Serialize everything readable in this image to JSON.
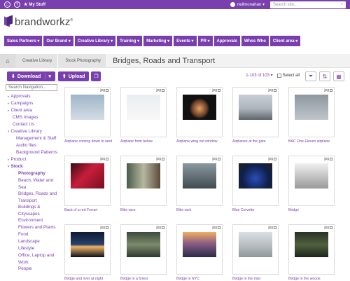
{
  "topbar": {
    "my_stuff": "My Stuff",
    "user": "neilmonahan ▾",
    "search_placeholder": "Search site..."
  },
  "logo": {
    "text": "brandworkz"
  },
  "nav": [
    "Sales Partners ▾",
    "Our Brand ▾",
    "Creative Library ▾",
    "Training ▾",
    "Marketing ▾",
    "Events ▾",
    "PR ▾",
    "Approvals",
    "Whos Who",
    "Client area ▾"
  ],
  "breadcrumb": {
    "items": [
      "Creative Library",
      "Stock Photography"
    ],
    "title": "Bridges, Roads and Transport"
  },
  "toolbar": {
    "download": "Download",
    "upload": "Upload",
    "count": "1-103 of 103 ▾",
    "select_all": "Select all"
  },
  "sidebar": {
    "search_placeholder": "Search Navigation...",
    "tree": [
      {
        "label": "Approvals",
        "level": "l0",
        "arrow": "▸"
      },
      {
        "label": "Campaigns",
        "level": "l0",
        "arrow": "▸"
      },
      {
        "label": "Client area",
        "level": "l0",
        "arrow": "▸"
      },
      {
        "label": "CMS Images",
        "level": "l1",
        "arrow": ""
      },
      {
        "label": "Contact Us",
        "level": "l1",
        "arrow": ""
      },
      {
        "label": "Creative Library",
        "level": "l0",
        "arrow": "▾"
      },
      {
        "label": "Management & Staff",
        "level": "l2",
        "arrow": ""
      },
      {
        "label": "Audio files",
        "level": "l2",
        "arrow": ""
      },
      {
        "label": "Background Patterns",
        "level": "l2",
        "arrow": ""
      },
      {
        "label": "Product",
        "level": "l1b",
        "arrow": "▸"
      },
      {
        "label": "Stock",
        "level": "l1b",
        "arrow": "▾",
        "bold": true
      },
      {
        "label": "Photography",
        "level": "l3",
        "arrow": "",
        "bold": true
      },
      {
        "label": "Beach, Water and Sea",
        "level": "l3",
        "arrow": "",
        "wrap": true
      },
      {
        "label": "Bridges, Roads and Transport",
        "level": "l3",
        "arrow": "",
        "wrap": true
      },
      {
        "label": "Buildings & Cityscapes",
        "level": "l3",
        "arrow": "",
        "wrap": true
      },
      {
        "label": "Environment",
        "level": "l3",
        "arrow": ""
      },
      {
        "label": "Flowers and Plants",
        "level": "l3",
        "arrow": ""
      },
      {
        "label": "Food",
        "level": "l3",
        "arrow": ""
      },
      {
        "label": "Landscape",
        "level": "l3",
        "arrow": ""
      },
      {
        "label": "Lifestyle",
        "level": "l3",
        "arrow": ""
      },
      {
        "label": "Office, Laptop and Work",
        "level": "l3",
        "arrow": "",
        "wrap": true
      },
      {
        "label": "People",
        "level": "l3",
        "arrow": ""
      }
    ]
  },
  "assets": [
    {
      "caption": "Airplane coming down to land",
      "type": "jpg",
      "theme": "sky1"
    },
    {
      "caption": "Airplane from below",
      "type": "jpg",
      "theme": "sky2"
    },
    {
      "caption": "Airplane wing out window",
      "type": "jpg",
      "theme": "window"
    },
    {
      "caption": "Airplanes at the gate",
      "type": "jpg",
      "theme": "gate"
    },
    {
      "caption": "BAC One Eleven airplane",
      "type": "jpg",
      "theme": "bac"
    },
    {
      "caption": "Back of a red Ferrari",
      "type": "jpg",
      "theme": "ferrari"
    },
    {
      "caption": "Bike race",
      "type": "jpg",
      "theme": "bike"
    },
    {
      "caption": "Bike rack",
      "type": "jpg",
      "theme": "rack"
    },
    {
      "caption": "Blue Corvette",
      "type": "jpg",
      "theme": "corvette"
    },
    {
      "caption": "Bridge",
      "type": "jpg",
      "theme": "bridge"
    },
    {
      "caption": "Bridge and river at night",
      "type": "jpg",
      "theme": "night"
    },
    {
      "caption": "Bridge in a forest",
      "type": "jpg",
      "theme": "forest"
    },
    {
      "caption": "Bridge in NYC",
      "type": "jpg",
      "theme": "nyc"
    },
    {
      "caption": "Bridge in the mist",
      "type": "jpg",
      "theme": "mist"
    },
    {
      "caption": "Bridge in the woods",
      "type": "jpg",
      "theme": "woods"
    }
  ],
  "colors": {
    "brand": "#7a3fae"
  }
}
